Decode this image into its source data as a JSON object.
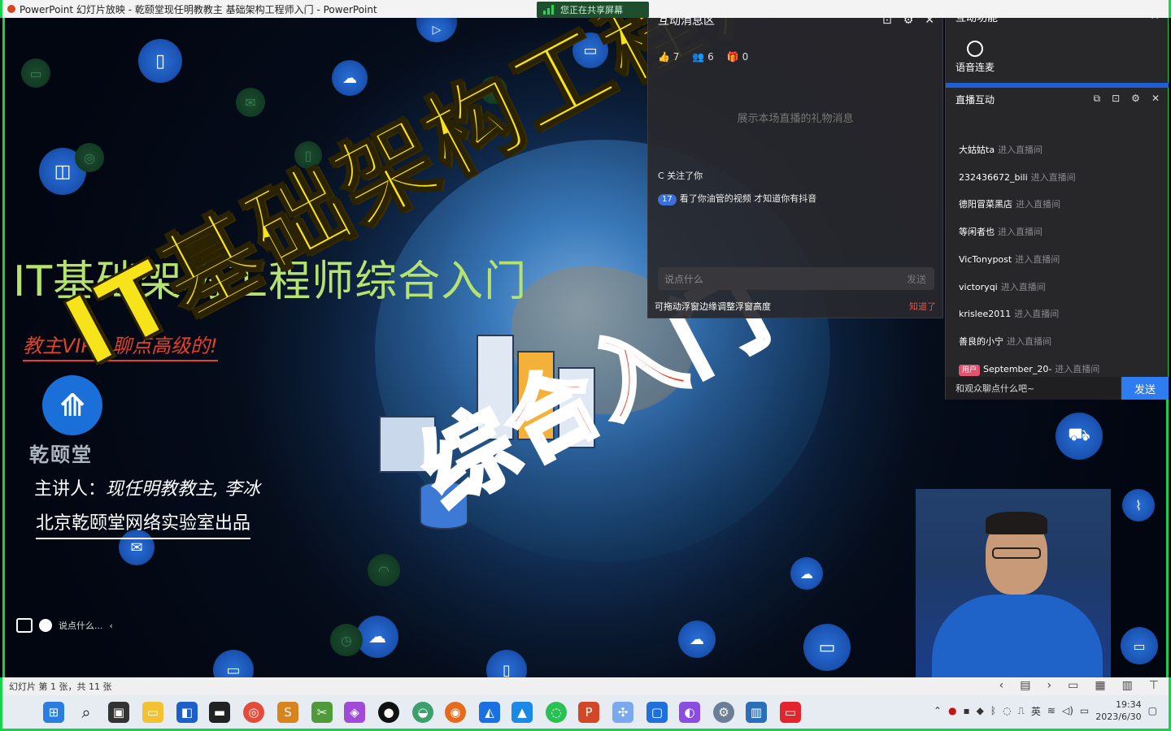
{
  "window": {
    "title": "PowerPoint 幻灯片放映 - 乾颐堂现任明教教主 基础架构工程师入门 - PowerPoint",
    "share_status": "您正在共享屏幕"
  },
  "slide": {
    "left_title": "IT基础架构工程师综合入门",
    "vip_line": "教主VIP，聊点高级的!",
    "logo_text": "乾颐堂",
    "speaker_label": "主讲人：",
    "speaker_name": "现任明教教主, 李冰",
    "producer": "北京乾颐堂网络实验室出品",
    "overlay_yellow": "IT基础架构工程师",
    "overlay_red": "综合入门",
    "chat_placeholder": "说点什么..."
  },
  "message_panel": {
    "title": "互动消息区",
    "likes": "7",
    "viewers": "6",
    "gifts": "0",
    "gift_placeholder": "展示本场直播的礼物消息",
    "lines": [
      {
        "badge": "",
        "text": "C 关注了你"
      },
      {
        "badge": "17",
        "text": "看了你油管的视频 才知道你有抖音"
      }
    ],
    "input_placeholder": "说点什么",
    "send_label": "发送",
    "tip": "可拖动浮窗边缘调整浮窗高度",
    "tip_ok": "知道了"
  },
  "function_panel": {
    "title": "互动功能",
    "voice_label": "语音连麦",
    "live_label": "直播互动",
    "entries": [
      {
        "name": "大姑姑ta",
        "action": "进入直播间",
        "tag": ""
      },
      {
        "name": "232436672_bili",
        "action": "进入直播间",
        "tag": ""
      },
      {
        "name": "德阳冒菜黑店",
        "action": "进入直播间",
        "tag": ""
      },
      {
        "name": "等闲者也",
        "action": "进入直播间",
        "tag": ""
      },
      {
        "name": "VicTonypost",
        "action": "进入直播间",
        "tag": ""
      },
      {
        "name": "victoryqi",
        "action": "进入直播间",
        "tag": ""
      },
      {
        "name": "krislee2011",
        "action": "进入直播间",
        "tag": ""
      },
      {
        "name": "善良的小宁",
        "action": "进入直播间",
        "tag": ""
      },
      {
        "name": "September_20-",
        "action": "进入直播间",
        "tag": "用户"
      }
    ],
    "input_placeholder": "和观众聊点什么吧~",
    "send_label": "发送"
  },
  "status_bar": {
    "slide_info": "幻灯片 第 1 张，共 11 张"
  },
  "taskbar": {
    "time": "19:34",
    "date": "2023/6/30"
  },
  "colors": {
    "accent_blue": "#2d7cf2",
    "title_yellow": "#f7e319",
    "title_red": "#f3361d",
    "left_title_green": "#b5e36e",
    "share_border": "#19d14b"
  }
}
